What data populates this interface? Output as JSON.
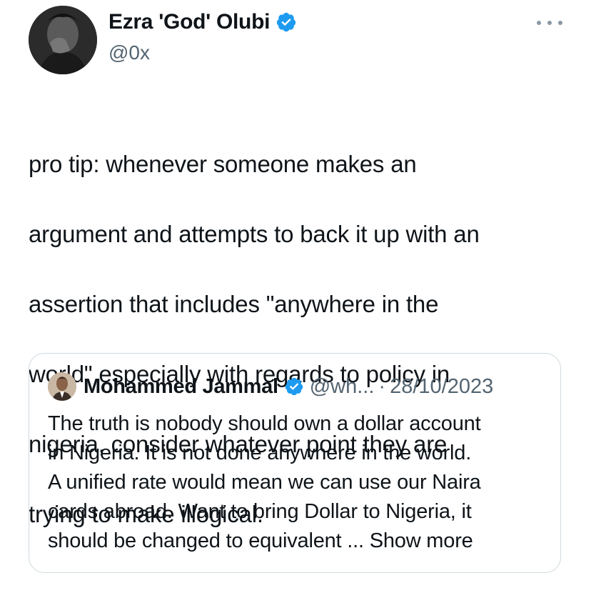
{
  "author": {
    "name": "Ezra 'God' Olubi",
    "handle": "@0x"
  },
  "tweet": {
    "lines": [
      "pro tip: whenever someone makes an",
      "argument and attempts to back it up with an",
      "assertion that includes \"anywhere in the",
      "world\" especially with regards to policy in",
      "nigeria, consider whatever point they are",
      "trying to make illogical."
    ]
  },
  "quote": {
    "name": "Mohammed Jammal",
    "handle": "@wh...",
    "separator": "·",
    "date": "28/10/2023",
    "lines": [
      "The truth is nobody should own a dollar account",
      "in Nigeria. It is not done anywhere in the world.",
      "A unified rate would mean we can use our Naira",
      "cards abroad. Want to bring Dollar to Nigeria, it",
      "should be changed to equivalent ..."
    ],
    "show_more": "Show more"
  },
  "colors": {
    "verified": "#1d9bf0",
    "secondary_text": "#536471",
    "border": "#cfd9de"
  },
  "icons": {
    "verified": "verified-badge-icon",
    "more": "more-options-icon"
  }
}
